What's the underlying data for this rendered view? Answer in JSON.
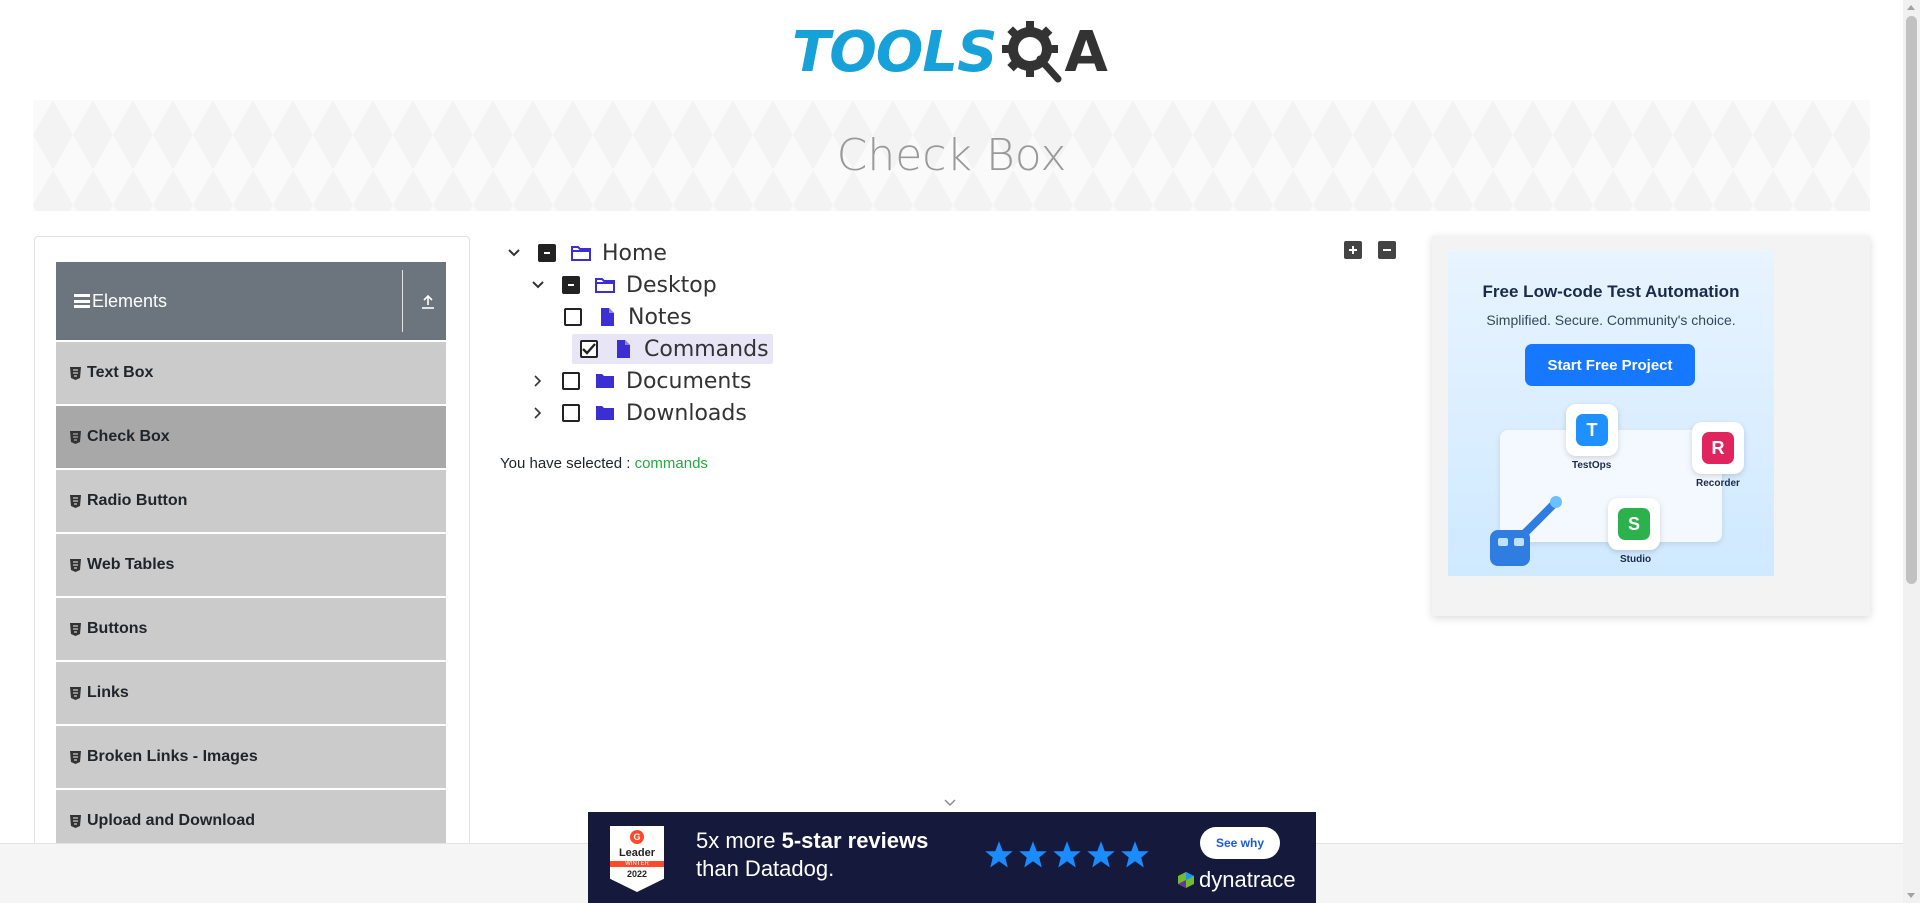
{
  "logo": {
    "left_text": "TOOLS",
    "right_text": "A"
  },
  "banner": {
    "title": "Check Box"
  },
  "sidebar": {
    "group_title": "Elements",
    "items": [
      {
        "label": "Text Box",
        "active": false
      },
      {
        "label": "Check Box",
        "active": true
      },
      {
        "label": "Radio Button",
        "active": false
      },
      {
        "label": "Web Tables",
        "active": false
      },
      {
        "label": "Buttons",
        "active": false
      },
      {
        "label": "Links",
        "active": false
      },
      {
        "label": "Broken Links - Images",
        "active": false
      },
      {
        "label": "Upload and Download",
        "active": false
      }
    ]
  },
  "tree": {
    "home": {
      "label": "Home",
      "state": "half",
      "expanded": true
    },
    "desktop": {
      "label": "Desktop",
      "state": "half",
      "expanded": true
    },
    "notes": {
      "label": "Notes",
      "state": "unchecked"
    },
    "commands": {
      "label": "Commands",
      "state": "checked"
    },
    "documents": {
      "label": "Documents",
      "state": "unchecked",
      "expanded": false
    },
    "downloads": {
      "label": "Downloads",
      "state": "unchecked",
      "expanded": false
    }
  },
  "result": {
    "prefix": "You have selected :",
    "value": "commands"
  },
  "right_ad": {
    "title": "Free Low-code Test Automation",
    "subtitle": "Simplified. Secure. Community's choice.",
    "button": "Start Free Project",
    "apps": [
      {
        "name": "TestOps",
        "letter": "T",
        "color": "#1e90ff"
      },
      {
        "name": "Recorder",
        "letter": "R",
        "color": "#e0245e"
      },
      {
        "name": "Studio",
        "letter": "S",
        "color": "#2bb24c"
      }
    ]
  },
  "bottom_ad": {
    "badge_top": "Leader",
    "badge_season": "WINTER",
    "badge_year": "2022",
    "line1_prefix": "5x more ",
    "line1_bold": "5-star reviews",
    "line2": "than Datadog.",
    "cta": "See why",
    "brand": "dynatrace"
  },
  "colors": {
    "accent_blue": "#16a1d8",
    "sidebar_header": "#6c757d",
    "selected_text": "#28a745",
    "folder": "#3b2fd4"
  }
}
